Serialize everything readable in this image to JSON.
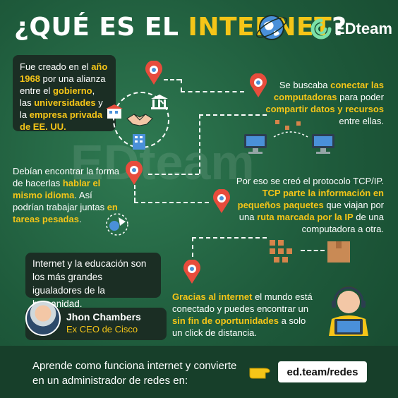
{
  "title": {
    "prefix": "¿QUÉ ES EL ",
    "highlight": "INTERNET",
    "suffix": "?"
  },
  "brand": {
    "name": "EDteam",
    "watermark": "EDteam"
  },
  "colors": {
    "accent": "#f5c518",
    "background": "#1e5a3b",
    "panel": "#1b2e24"
  },
  "block1": {
    "t1": "Fue creado en el ",
    "h1": "año 1968",
    "t2": " por una alianza entre el ",
    "h2": "gobierno",
    "t3": ", las ",
    "h3": "universidades",
    "t4": " y la ",
    "h4": "empresa privada de EE. UU."
  },
  "block2": {
    "t1": "Se buscaba ",
    "h1": "conectar las computadoras",
    "t2": " para poder ",
    "h2": "compartir datos y recursos",
    "t3": " entre ellas."
  },
  "block3": {
    "t1": "Debían encontrar la forma de hacerlas ",
    "h1": "hablar el mismo idioma",
    "t2": ". Así podrían trabajar juntas ",
    "h2": "en tareas pesadas",
    "t3": "."
  },
  "block4": {
    "t1": "Por eso se creó el protocolo TCP/IP. ",
    "h1": "TCP parte la información en pequeños paquetes",
    "t2": " que viajan por una ",
    "h2": "ruta marcada por la IP",
    "t3": " de una computadora a otra."
  },
  "block5": {
    "h1": "Gracias al internet",
    "t1": " el mundo está conectado y puedes encontrar un ",
    "h2": "sin fin de oportunidades",
    "t2": " a solo un click de distancia."
  },
  "quote": {
    "text": "Internet y la educación son los más grandes igualadores de la humanidad.",
    "author": "Jhon Chambers",
    "role": "Ex CEO de Cisco"
  },
  "footer": {
    "text": "Aprende como funciona internet y convierte en un administrador de redes en:",
    "url": "ed.team/redes",
    "pointer_icon": "pointing-hand-icon"
  },
  "icons": [
    "globe-icon",
    "map-pin-icon",
    "government-building-icon",
    "handshake-icon",
    "office-building-icon",
    "computer-icon",
    "data-packet-icon",
    "box-icon",
    "satellite-icon",
    "support-agent-icon"
  ]
}
